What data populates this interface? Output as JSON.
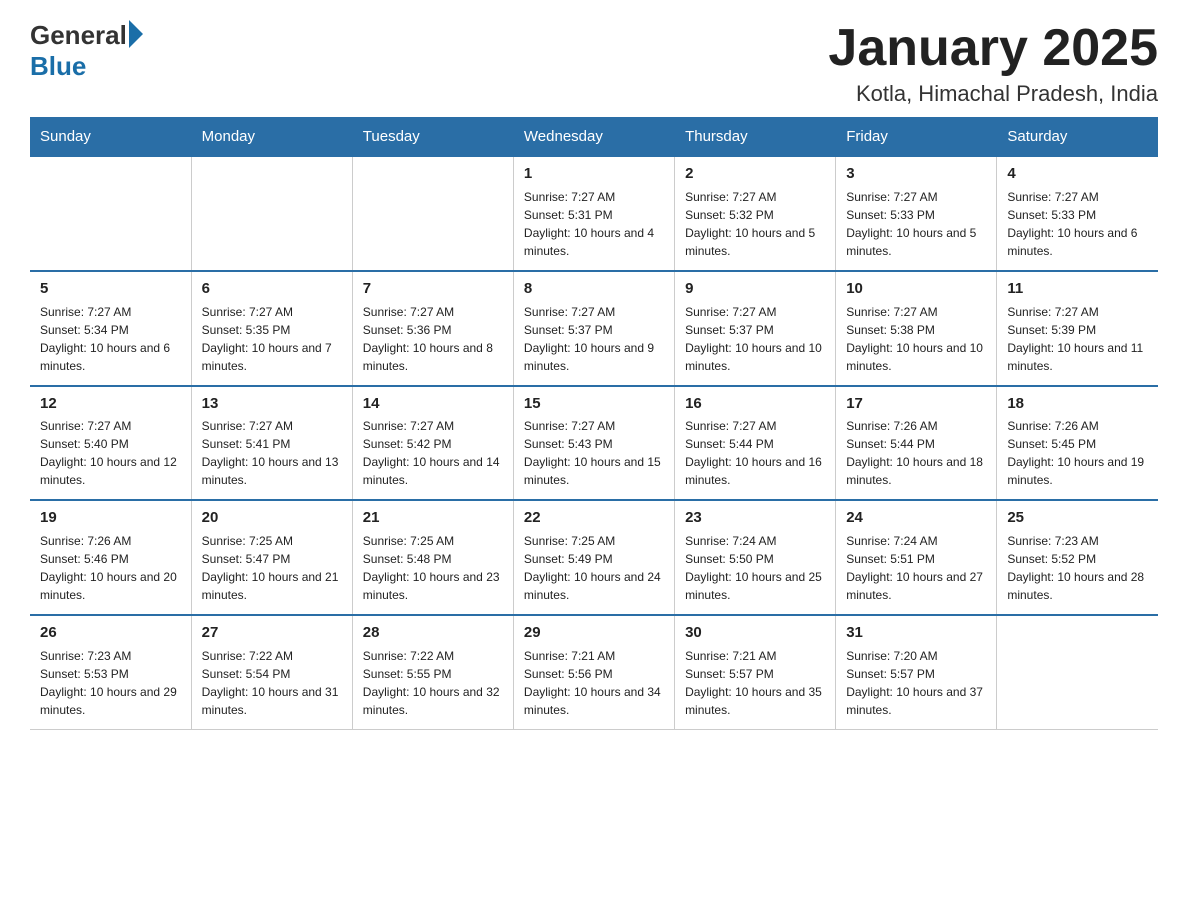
{
  "logo": {
    "general": "General",
    "blue": "Blue"
  },
  "title": "January 2025",
  "subtitle": "Kotla, Himachal Pradesh, India",
  "weekdays": [
    "Sunday",
    "Monday",
    "Tuesday",
    "Wednesday",
    "Thursday",
    "Friday",
    "Saturday"
  ],
  "weeks": [
    [
      {
        "day": "",
        "info": ""
      },
      {
        "day": "",
        "info": ""
      },
      {
        "day": "",
        "info": ""
      },
      {
        "day": "1",
        "info": "Sunrise: 7:27 AM\nSunset: 5:31 PM\nDaylight: 10 hours and 4 minutes."
      },
      {
        "day": "2",
        "info": "Sunrise: 7:27 AM\nSunset: 5:32 PM\nDaylight: 10 hours and 5 minutes."
      },
      {
        "day": "3",
        "info": "Sunrise: 7:27 AM\nSunset: 5:33 PM\nDaylight: 10 hours and 5 minutes."
      },
      {
        "day": "4",
        "info": "Sunrise: 7:27 AM\nSunset: 5:33 PM\nDaylight: 10 hours and 6 minutes."
      }
    ],
    [
      {
        "day": "5",
        "info": "Sunrise: 7:27 AM\nSunset: 5:34 PM\nDaylight: 10 hours and 6 minutes."
      },
      {
        "day": "6",
        "info": "Sunrise: 7:27 AM\nSunset: 5:35 PM\nDaylight: 10 hours and 7 minutes."
      },
      {
        "day": "7",
        "info": "Sunrise: 7:27 AM\nSunset: 5:36 PM\nDaylight: 10 hours and 8 minutes."
      },
      {
        "day": "8",
        "info": "Sunrise: 7:27 AM\nSunset: 5:37 PM\nDaylight: 10 hours and 9 minutes."
      },
      {
        "day": "9",
        "info": "Sunrise: 7:27 AM\nSunset: 5:37 PM\nDaylight: 10 hours and 10 minutes."
      },
      {
        "day": "10",
        "info": "Sunrise: 7:27 AM\nSunset: 5:38 PM\nDaylight: 10 hours and 10 minutes."
      },
      {
        "day": "11",
        "info": "Sunrise: 7:27 AM\nSunset: 5:39 PM\nDaylight: 10 hours and 11 minutes."
      }
    ],
    [
      {
        "day": "12",
        "info": "Sunrise: 7:27 AM\nSunset: 5:40 PM\nDaylight: 10 hours and 12 minutes."
      },
      {
        "day": "13",
        "info": "Sunrise: 7:27 AM\nSunset: 5:41 PM\nDaylight: 10 hours and 13 minutes."
      },
      {
        "day": "14",
        "info": "Sunrise: 7:27 AM\nSunset: 5:42 PM\nDaylight: 10 hours and 14 minutes."
      },
      {
        "day": "15",
        "info": "Sunrise: 7:27 AM\nSunset: 5:43 PM\nDaylight: 10 hours and 15 minutes."
      },
      {
        "day": "16",
        "info": "Sunrise: 7:27 AM\nSunset: 5:44 PM\nDaylight: 10 hours and 16 minutes."
      },
      {
        "day": "17",
        "info": "Sunrise: 7:26 AM\nSunset: 5:44 PM\nDaylight: 10 hours and 18 minutes."
      },
      {
        "day": "18",
        "info": "Sunrise: 7:26 AM\nSunset: 5:45 PM\nDaylight: 10 hours and 19 minutes."
      }
    ],
    [
      {
        "day": "19",
        "info": "Sunrise: 7:26 AM\nSunset: 5:46 PM\nDaylight: 10 hours and 20 minutes."
      },
      {
        "day": "20",
        "info": "Sunrise: 7:25 AM\nSunset: 5:47 PM\nDaylight: 10 hours and 21 minutes."
      },
      {
        "day": "21",
        "info": "Sunrise: 7:25 AM\nSunset: 5:48 PM\nDaylight: 10 hours and 23 minutes."
      },
      {
        "day": "22",
        "info": "Sunrise: 7:25 AM\nSunset: 5:49 PM\nDaylight: 10 hours and 24 minutes."
      },
      {
        "day": "23",
        "info": "Sunrise: 7:24 AM\nSunset: 5:50 PM\nDaylight: 10 hours and 25 minutes."
      },
      {
        "day": "24",
        "info": "Sunrise: 7:24 AM\nSunset: 5:51 PM\nDaylight: 10 hours and 27 minutes."
      },
      {
        "day": "25",
        "info": "Sunrise: 7:23 AM\nSunset: 5:52 PM\nDaylight: 10 hours and 28 minutes."
      }
    ],
    [
      {
        "day": "26",
        "info": "Sunrise: 7:23 AM\nSunset: 5:53 PM\nDaylight: 10 hours and 29 minutes."
      },
      {
        "day": "27",
        "info": "Sunrise: 7:22 AM\nSunset: 5:54 PM\nDaylight: 10 hours and 31 minutes."
      },
      {
        "day": "28",
        "info": "Sunrise: 7:22 AM\nSunset: 5:55 PM\nDaylight: 10 hours and 32 minutes."
      },
      {
        "day": "29",
        "info": "Sunrise: 7:21 AM\nSunset: 5:56 PM\nDaylight: 10 hours and 34 minutes."
      },
      {
        "day": "30",
        "info": "Sunrise: 7:21 AM\nSunset: 5:57 PM\nDaylight: 10 hours and 35 minutes."
      },
      {
        "day": "31",
        "info": "Sunrise: 7:20 AM\nSunset: 5:57 PM\nDaylight: 10 hours and 37 minutes."
      },
      {
        "day": "",
        "info": ""
      }
    ]
  ]
}
